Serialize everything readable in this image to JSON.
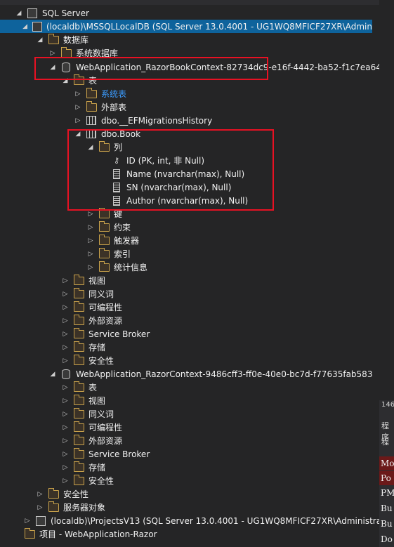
{
  "tree": {
    "sql_server": "SQL Server",
    "localdb_mssql": "(localdb)\\MSSQLLocalDB (SQL Server 13.0.4001 - UG1WQ8MFICF27XR\\Admin",
    "databases": "数据库",
    "system_databases": "系统数据库",
    "db1": "WebApplication_RazorBookContext-82734dc9-e16f-4442-ba52-f1c7ea64",
    "tables": "表",
    "system_tables": "系统表",
    "external_tables": "外部表",
    "efmigrations": "dbo.__EFMigrationsHistory",
    "dbo_book": "dbo.Book",
    "columns": "列",
    "col_id": "ID (PK, int, 非 Null)",
    "col_name": "Name (nvarchar(max), Null)",
    "col_sn": "SN (nvarchar(max), Null)",
    "col_author": "Author (nvarchar(max), Null)",
    "keys": "键",
    "constraints": "约束",
    "triggers": "触发器",
    "indexes": "索引",
    "statistics": "统计信息",
    "views": "视图",
    "synonyms": "同义词",
    "programmability": "可编程性",
    "external_resources": "外部资源",
    "service_broker": "Service Broker",
    "storage": "存储",
    "security": "安全性",
    "db2": "WebApplication_RazorContext-9486cff3-ff0e-40e0-bc7d-f77635fab583",
    "db2_tables": "表",
    "db2_views": "视图",
    "db2_synonyms": "同义词",
    "db2_programmability": "可编程性",
    "db2_external_resources": "外部资源",
    "db2_service_broker": "Service Broker",
    "db2_storage": "存储",
    "db2_security": "安全性",
    "server_security": "安全性",
    "server_objects": "服务器对象",
    "localdb_projects": "(localdb)\\ProjectsV13 (SQL Server 13.0.4001 - UG1WQ8MFICF27XR\\Administra",
    "project": "项目 - WebApplication-Razor"
  },
  "right_pane": {
    "number": "146",
    "header1": "程序",
    "header2": "程",
    "items": [
      "Mo",
      "Po",
      "PM",
      "Bu",
      "Bu",
      "Do"
    ]
  },
  "colors": {
    "selection": "#0e639c",
    "highlight": "#e81123",
    "system_table_text": "#3b9cff"
  }
}
